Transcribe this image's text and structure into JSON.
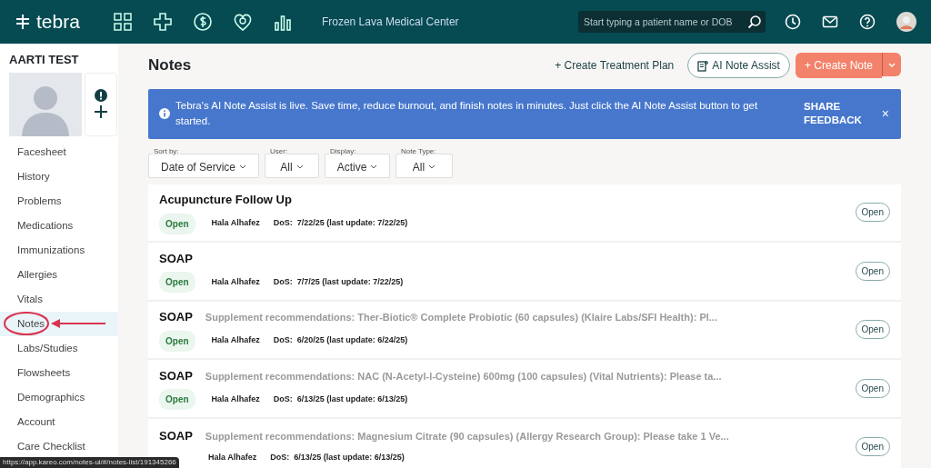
{
  "navbar": {
    "brand": "tebra",
    "practice": "Frozen Lava Medical Center",
    "search": {
      "placeholder": "Start typing a patient name or DOB"
    }
  },
  "patient": {
    "name": "AARTI TEST"
  },
  "sidebar": {
    "items": [
      {
        "label": "Facesheet",
        "selected": false
      },
      {
        "label": "History",
        "selected": false
      },
      {
        "label": "Problems",
        "selected": false
      },
      {
        "label": "Medications",
        "selected": false
      },
      {
        "label": "Immunizations",
        "selected": false
      },
      {
        "label": "Allergies",
        "selected": false
      },
      {
        "label": "Vitals",
        "selected": false
      },
      {
        "label": "Notes",
        "selected": true,
        "annotated": true
      },
      {
        "label": "Labs/Studies",
        "selected": false
      },
      {
        "label": "Flowsheets",
        "selected": false
      },
      {
        "label": "Demographics",
        "selected": false
      },
      {
        "label": "Account",
        "selected": false
      },
      {
        "label": "Care Checklist",
        "selected": false
      }
    ]
  },
  "page": {
    "title": "Notes",
    "actions": [
      {
        "kind": "link",
        "label": "+ Create Treatment Plan"
      },
      {
        "kind": "outline",
        "label": "AI Note Assist"
      },
      {
        "kind": "split",
        "label": "+ Create Note"
      }
    ]
  },
  "banner": {
    "text": "Tebra's AI Note Assist is live. Save time, reduce burnout, and finish notes in minutes. Just click the AI Note Assist button to get started.",
    "action": "SHARE FEEDBACK",
    "close": "×"
  },
  "filters": [
    {
      "label": "Sort by:",
      "value": "Date of Service"
    },
    {
      "label": "User:",
      "value": "All"
    },
    {
      "label": "Display:",
      "value": "Active"
    },
    {
      "label": "Note Type:",
      "value": "All"
    }
  ],
  "notes": [
    {
      "title": "Acupuncture Follow Up",
      "status": "Open",
      "author": "Hala Alhafez",
      "dos": "DoS:  7/22/25 (last update: 7/22/25)",
      "button": "Open"
    },
    {
      "title": "SOAP",
      "status": "Open",
      "author": "Hala Alhafez",
      "dos": "DoS:  7/7/25 (last update: 7/22/25)",
      "button": "Open"
    },
    {
      "title": "SOAP",
      "summary": "Supplement recommendations: Ther-Biotic® Complete Probiotic (60 capsules) (Klaire Labs/SFI Health): Pl...",
      "status": "Open",
      "author": "Hala Alhafez",
      "dos": "DoS:  6/20/25 (last update: 6/24/25)",
      "button": "Open"
    },
    {
      "title": "SOAP",
      "summary": "Supplement recommendations: NAC (N-Acetyl-l-Cysteine) 600mg (100 capsules) (Vital Nutrients): Please ta...",
      "status": "Open",
      "author": "Hala Alhafez",
      "dos": "DoS:  6/13/25 (last update: 6/13/25)",
      "button": "Open"
    },
    {
      "title": "SOAP",
      "summary": "Supplement recommendations: Magnesium Citrate (90 capsules) (Allergy Research Group): Please take 1 Ve...",
      "author": "Hala Alhafez",
      "dos": "DoS:  6/13/25 (last update: 6/13/25)",
      "button": "Open"
    }
  ],
  "status_bar": "https://app.kareo.com/notes-ui/#/notes-list/191345266"
}
